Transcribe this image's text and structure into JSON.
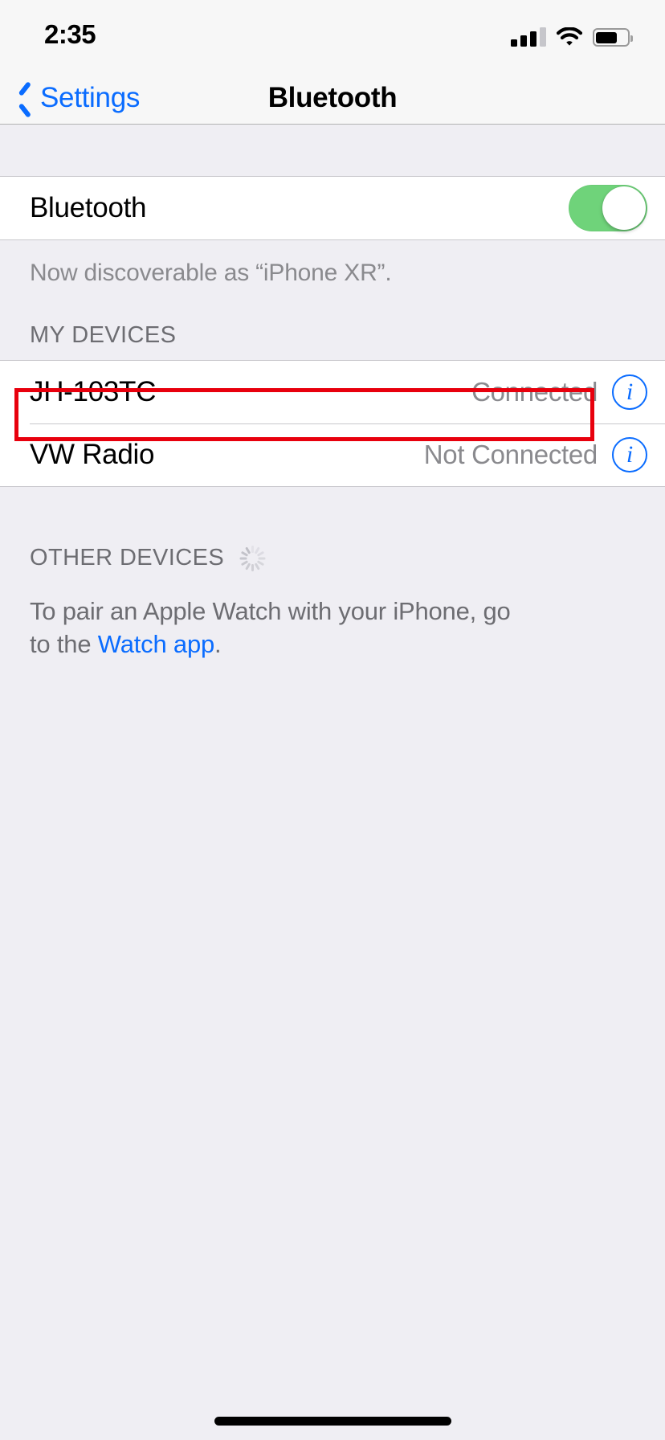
{
  "status_bar": {
    "time": "2:35",
    "cellular_icon": "cellular-signal-icon",
    "cellular_bars_filled": 3,
    "cellular_bars_total": 4,
    "wifi_icon": "wifi-icon",
    "battery_icon": "battery-icon",
    "battery_fill_percent": 65
  },
  "nav_bar": {
    "back_label": "Settings",
    "back_icon": "chevron-left-icon",
    "title": "Bluetooth"
  },
  "bluetooth_toggle": {
    "label": "Bluetooth",
    "state": "on",
    "accent_color": "#6FD37A"
  },
  "discoverable_footer": "Now discoverable as “iPhone XR”.",
  "my_devices": {
    "header": "MY DEVICES",
    "devices": [
      {
        "name": "JH-103TC",
        "status": "Connected",
        "info_label": "i",
        "highlighted": true
      },
      {
        "name": "VW Radio",
        "status": "Not Connected",
        "info_label": "i",
        "highlighted": false
      }
    ]
  },
  "other_devices": {
    "header": "OTHER DEVICES",
    "spinner_icon": "activity-spinner-icon",
    "pair_text_before": "To pair an Apple Watch with your iPhone, go to the ",
    "pair_link": "Watch app",
    "pair_text_after": "."
  },
  "annotation": {
    "highlight_color": "#E8000D",
    "target": "JH-103TC"
  },
  "home_indicator": "home-indicator"
}
